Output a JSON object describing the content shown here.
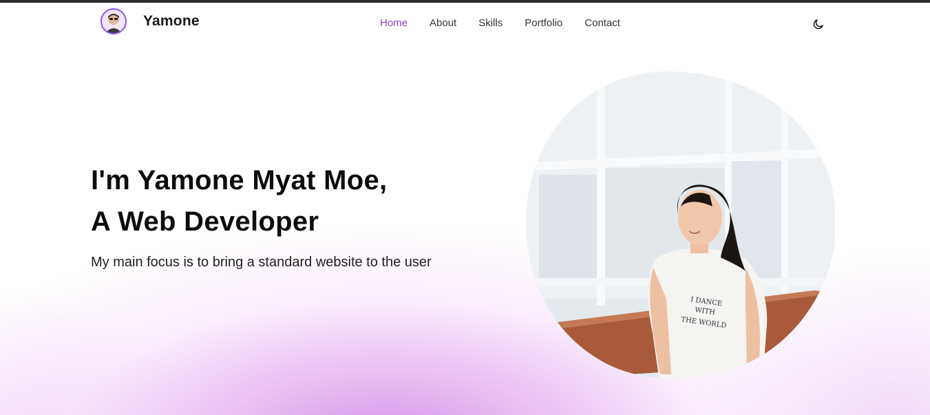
{
  "brand": {
    "name": "Yamone",
    "avatar_alt": "avatar"
  },
  "nav": {
    "items": [
      {
        "label": "Home",
        "active": true
      },
      {
        "label": "About",
        "active": false
      },
      {
        "label": "Skills",
        "active": false
      },
      {
        "label": "Portfolio",
        "active": false
      },
      {
        "label": "Contact",
        "active": false
      }
    ],
    "theme_icon": "moon-icon"
  },
  "hero": {
    "title_line1": "I'm Yamone Myat Moe,",
    "title_line2": "A Web Developer",
    "subtitle": "My main focus is to bring a standard website to the user",
    "shirt_text": [
      "I DANCE",
      "WITH",
      "THE WORLD"
    ]
  },
  "colors": {
    "accent": "#8a3fbf",
    "avatar_ring": "#8a4ff0",
    "gradient_pink": "#d68ce8",
    "topbar": "#2b2b2b",
    "text": "#0d0d0d"
  }
}
